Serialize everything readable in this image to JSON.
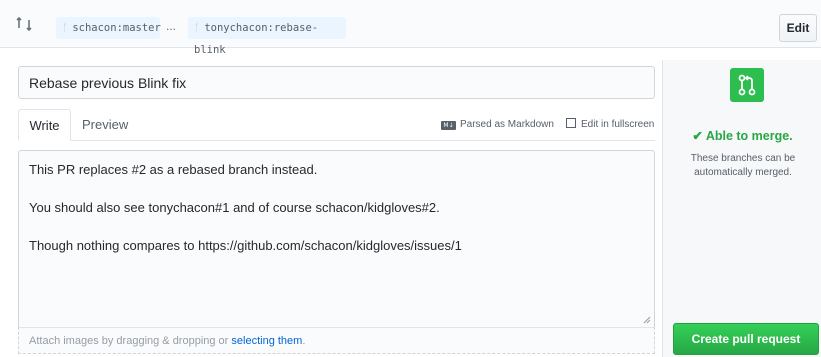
{
  "compare": {
    "icon": "compare-arrows-icon",
    "base_branch": "schacon:master",
    "separator": "...",
    "head_branch": "tonychacon:rebase-blink",
    "edit_label": "Edit"
  },
  "form": {
    "title_value": "Rebase previous Blink fix",
    "tabs": [
      {
        "label": "Write",
        "active": true
      },
      {
        "label": "Preview",
        "active": false
      }
    ],
    "markdown_note": "Parsed as Markdown",
    "markdown_badge": "M↓",
    "fullscreen_label": "Edit in fullscreen",
    "body_lines": [
      "This PR replaces #2 as a rebased branch instead.",
      "You should also see tonychacon#1 and of course schacon/kidgloves#2.",
      "Though nothing compares to https://github.com/schacon/kidgloves/issues/1"
    ],
    "attach_text": "Attach images by dragging & dropping or ",
    "attach_link": "selecting them",
    "attach_suffix": "."
  },
  "sidebar": {
    "icon": "git-pull-request-icon",
    "status": "✔ Able to merge.",
    "description": "These branches can be automatically merged.",
    "create_label": "Create pull request"
  },
  "colors": {
    "merge_green": "#28a745",
    "link_blue": "#0366d6",
    "branch_bg": "#eaf5ff"
  }
}
